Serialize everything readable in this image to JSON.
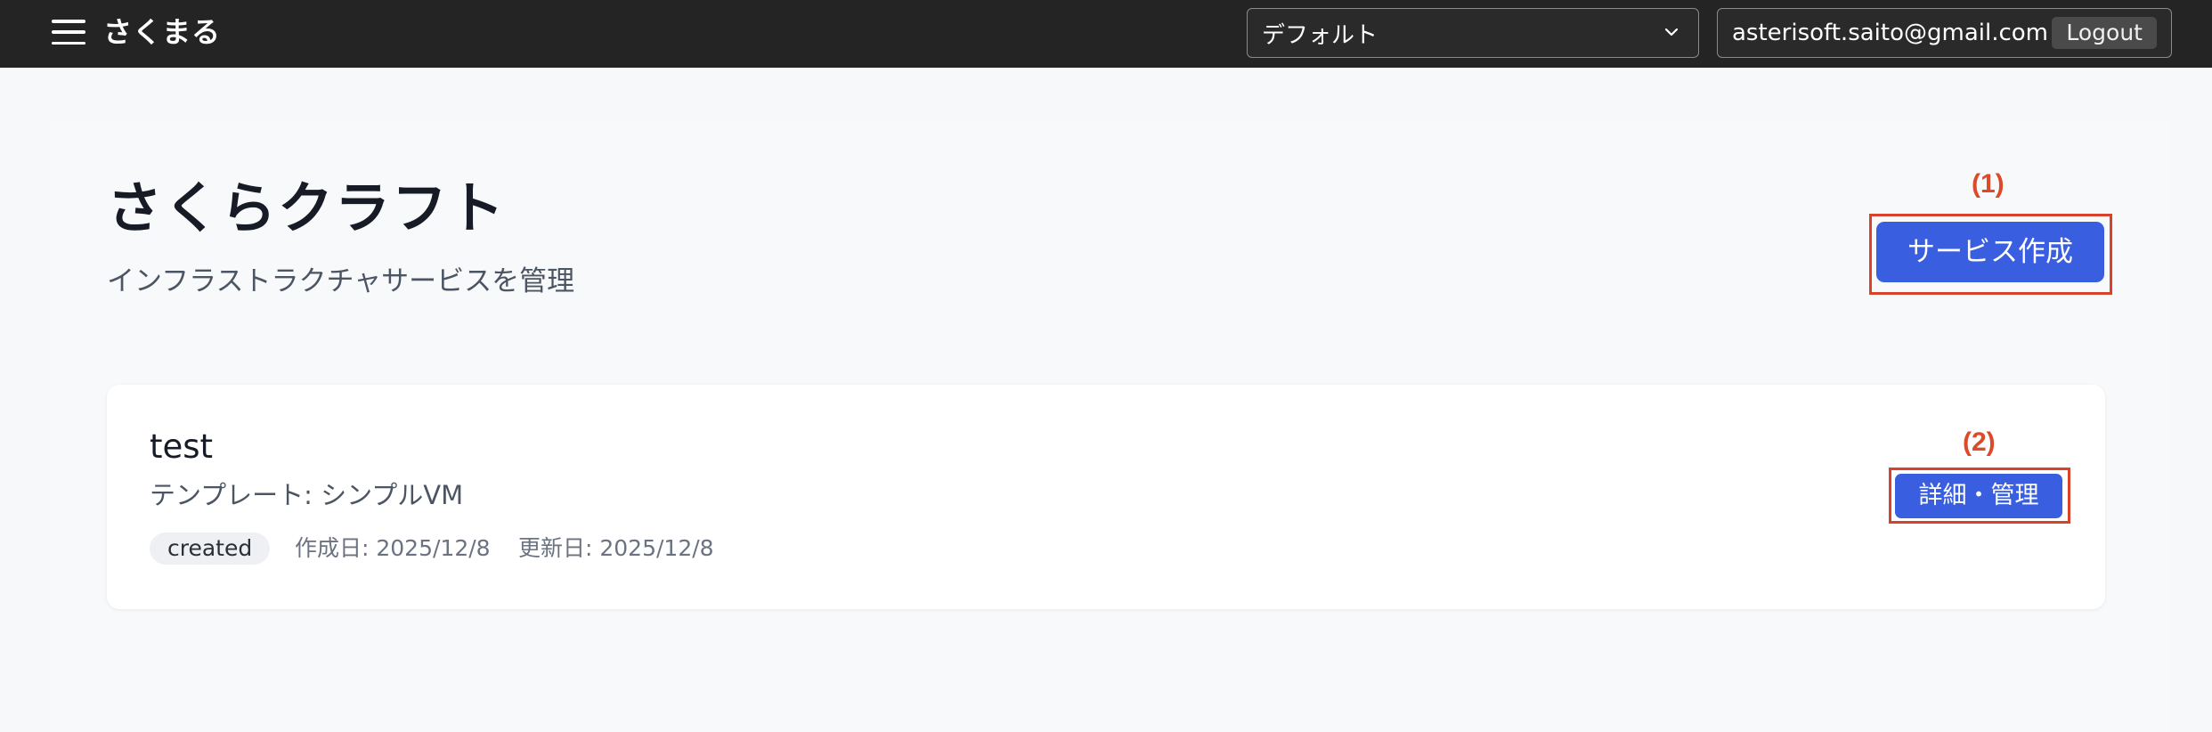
{
  "app": {
    "name": "さくまる"
  },
  "header": {
    "organization_select": {
      "value": "デフォルト"
    },
    "user": {
      "email": "asterisoft.saito@gmail.com",
      "logout_label": "Logout"
    }
  },
  "page": {
    "title": "さくらクラフト",
    "subtitle": "インフラストラクチャサービスを管理",
    "create_label": "サービス作成"
  },
  "annotations": {
    "first": "(1)",
    "second": "(2)",
    "color": "#dc4a2a"
  },
  "services": [
    {
      "name": "test",
      "template": "テンプレート: シンプルVM",
      "status": "created",
      "created": "作成日: 2025/12/8",
      "updated": "更新日: 2025/12/8",
      "detail_label": "詳細・管理"
    }
  ],
  "colors": {
    "topbar": "#242424",
    "primary": "#3a5ee0",
    "background": "#f7f8fa"
  }
}
